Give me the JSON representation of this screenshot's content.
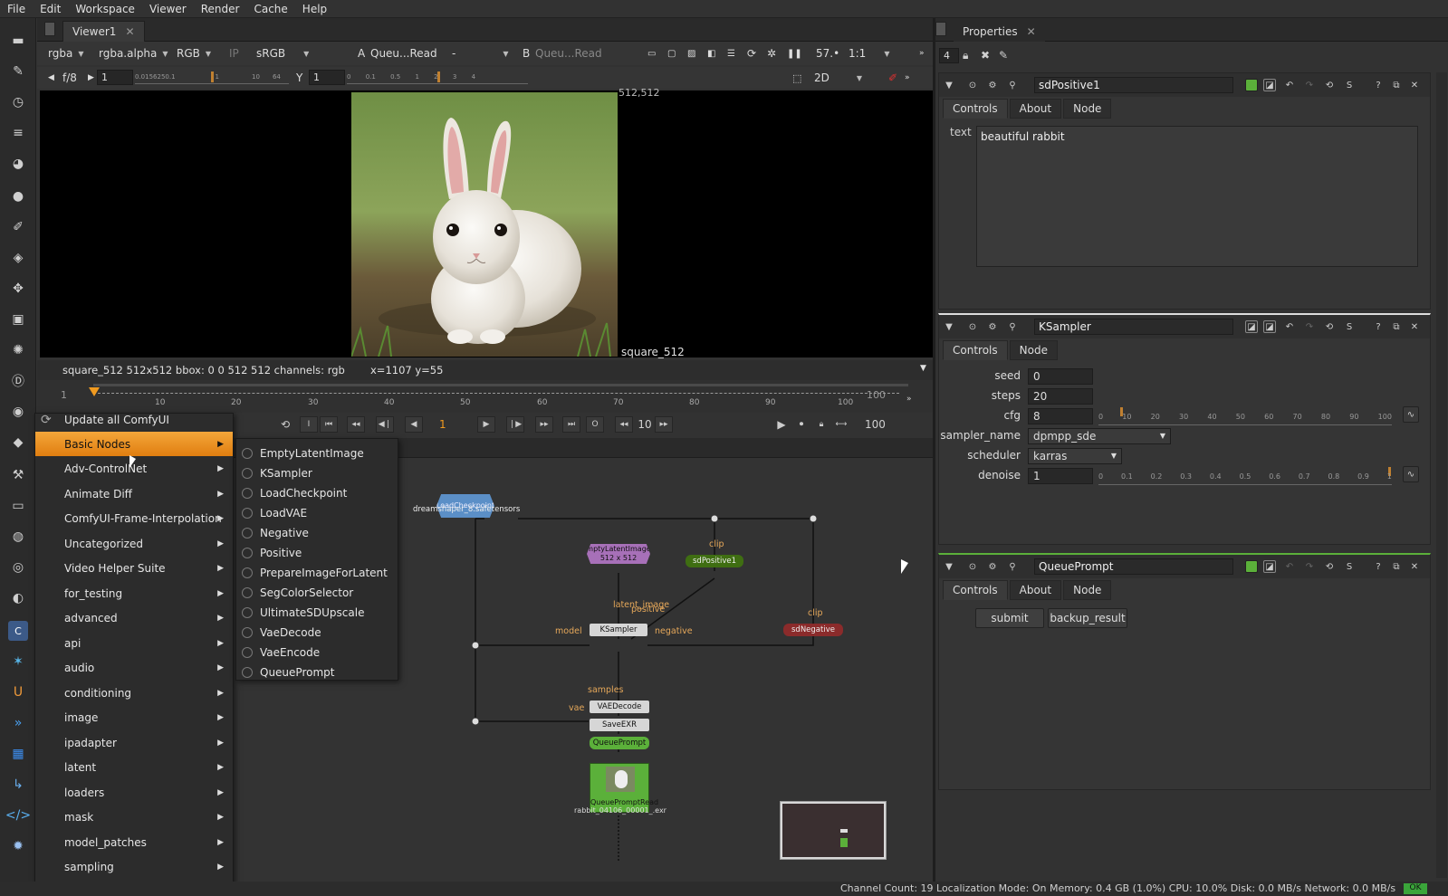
{
  "menubar": [
    "File",
    "Edit",
    "Workspace",
    "Viewer",
    "Render",
    "Cache",
    "Help"
  ],
  "viewer": {
    "tab": "Viewer1",
    "channels": "rgba",
    "alpha": "rgba.alpha",
    "colorspace": "RGB",
    "ip": "IP",
    "lut": "sRGB",
    "a_label": "A",
    "a_input": "Queu...Read",
    "a_op": "-",
    "b_label": "B",
    "b_input": "Queu...Read",
    "zoom": "57.•",
    "ratio": "1:1",
    "fstop": "f/8",
    "gain": "1",
    "y_label": "Y",
    "gamma": "1",
    "view_mode": "2D",
    "gain_ticks": [
      "0.015625",
      "0.1",
      "1",
      "10",
      "64"
    ],
    "gamma_ticks": [
      "0",
      "0.1",
      "0.5",
      "1",
      "2",
      "3",
      "4"
    ],
    "format_label": "square_512",
    "corner_label": "512,512",
    "info": "square_512 512x512  bbox: 0 0 512 512 channels: rgb",
    "coords": "x=1107 y=55"
  },
  "timeline": {
    "start": "1",
    "end": "100",
    "current": "1",
    "end2": "100",
    "step": "10",
    "ticks": [
      "10",
      "20",
      "30",
      "40",
      "50",
      "60",
      "70",
      "80",
      "90",
      "100"
    ]
  },
  "context_menu": {
    "items": [
      "Update all ComfyUI",
      "Basic Nodes",
      "Adv-ControlNet",
      "Animate Diff",
      "ComfyUI-Frame-Interpolation",
      "Uncategorized",
      "Video Helper Suite",
      "for_testing",
      "advanced",
      "api",
      "audio",
      "conditioning",
      "image",
      "ipadapter",
      "latent",
      "loaders",
      "mask",
      "model_patches",
      "sampling"
    ],
    "highlighted": "Basic Nodes"
  },
  "submenu": {
    "items": [
      "EmptyLatentImage",
      "KSampler",
      "LoadCheckpoint",
      "LoadVAE",
      "Negative",
      "Positive",
      "PrepareImageForLatent",
      "SegColorSelector",
      "UltimateSDUpscale",
      "VaeDecode",
      "VaeEncode",
      "QueuePrompt"
    ]
  },
  "dag": {
    "load_ckpt": "LoadCheckpoint",
    "load_ckpt_file": "dreamshaper_8.safetensors",
    "empty_latent": "EmptyLatentImage3",
    "empty_latent_size": "512 x 512",
    "positive": "sdPositive1",
    "negative": "sdNegative",
    "ksampler": "KSampler",
    "vaedecode": "VAEDecode",
    "saveexr": "SaveEXR",
    "queueprompt": "QueuePrompt",
    "qpread": "QueuePromptRead",
    "qpread_file": "rabbit_04106_00001_.exr",
    "lbl_clip": "clip",
    "lbl_latent": "latent_image",
    "lbl_positive": "positive",
    "lbl_model": "model",
    "lbl_negative": "negative",
    "lbl_samples": "samples",
    "lbl_vae": "vae",
    "lbl_clip2": "clip"
  },
  "properties": {
    "tab": "Properties",
    "max_panels": "4",
    "panel1": {
      "name": "sdPositive1",
      "tabs": [
        "Controls",
        "About",
        "Node"
      ],
      "text_label": "text",
      "text_value": "beautiful rabbit"
    },
    "panel2": {
      "name": "KSampler",
      "tabs": [
        "Controls",
        "Node"
      ],
      "seed_label": "seed",
      "seed": "0",
      "steps_label": "steps",
      "steps": "20",
      "cfg_label": "cfg",
      "cfg": "8",
      "cfg_ticks": [
        "0",
        "10",
        "20",
        "30",
        "40",
        "50",
        "60",
        "70",
        "80",
        "90",
        "100"
      ],
      "sampler_label": "sampler_name",
      "sampler": "dpmpp_sde",
      "scheduler_label": "scheduler",
      "scheduler": "karras",
      "denoise_label": "denoise",
      "denoise": "1",
      "denoise_ticks": [
        "0",
        "0.1",
        "0.2",
        "0.3",
        "0.4",
        "0.5",
        "0.6",
        "0.7",
        "0.8",
        "0.9",
        "1"
      ]
    },
    "panel3": {
      "name": "QueuePrompt",
      "tabs": [
        "Controls",
        "About",
        "Node"
      ],
      "submit": "submit",
      "backup": "backup_result"
    }
  },
  "status": "Channel Count: 19  Localization Mode: On  Memory: 0.4 GB (1.0%) CPU: 10.0% Disk: 0.0 MB/s Network: 0.0 MB/s",
  "status_ok": "OK",
  "colors": {
    "accent": "#f08c1e",
    "positive_node": "#3f6e12",
    "negative_node": "#8b2b2b",
    "latent_node": "#a770b8",
    "ckpt_node": "#5b8fc7",
    "queue_node": "#5bb03a"
  }
}
